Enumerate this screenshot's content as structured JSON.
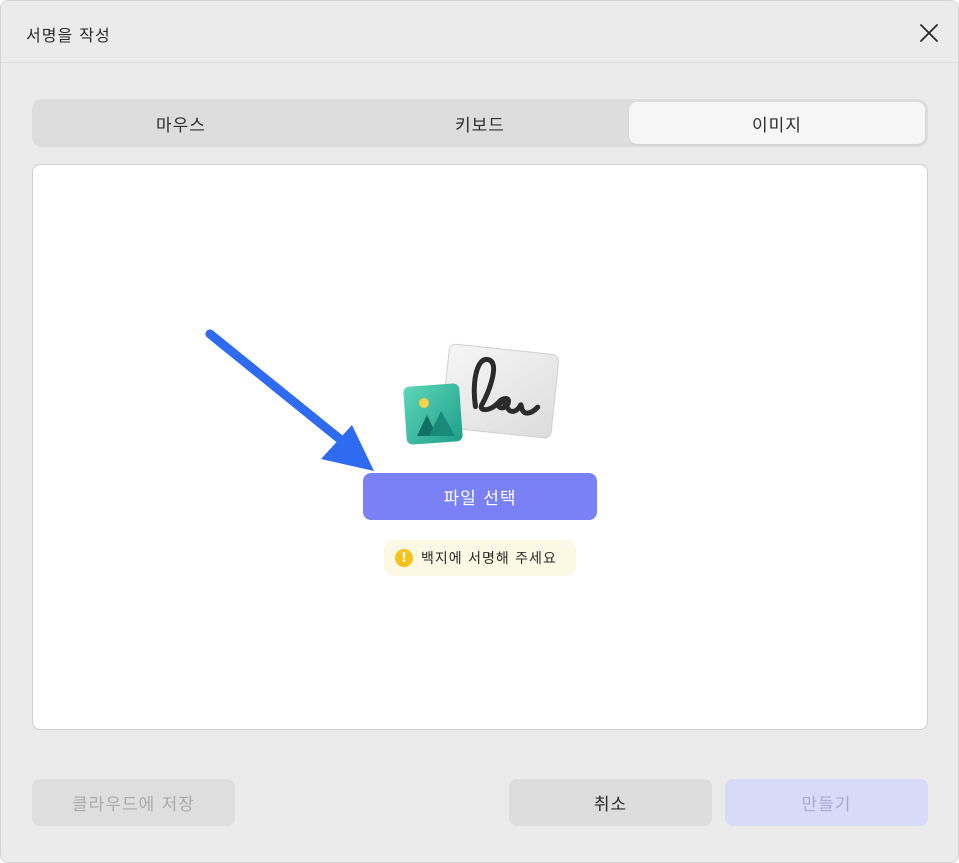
{
  "dialog": {
    "title": "서명을 작성"
  },
  "tabs": [
    {
      "label": "마우스",
      "active": false
    },
    {
      "label": "키보드",
      "active": false
    },
    {
      "label": "이미지",
      "active": true
    }
  ],
  "image_panel": {
    "file_button_label": "파일 선택",
    "hint_text": "백지에 서명해 주세요",
    "hint_icon": "warning-icon"
  },
  "footer": {
    "save_cloud_label": "클라우드에 저장",
    "cancel_label": "취소",
    "create_label": "만들기"
  },
  "colors": {
    "accent": "#7a80f6",
    "annotation_arrow": "#2f6bf0",
    "hint_bg": "#fdf8e4",
    "hint_icon": "#f6c21a"
  }
}
